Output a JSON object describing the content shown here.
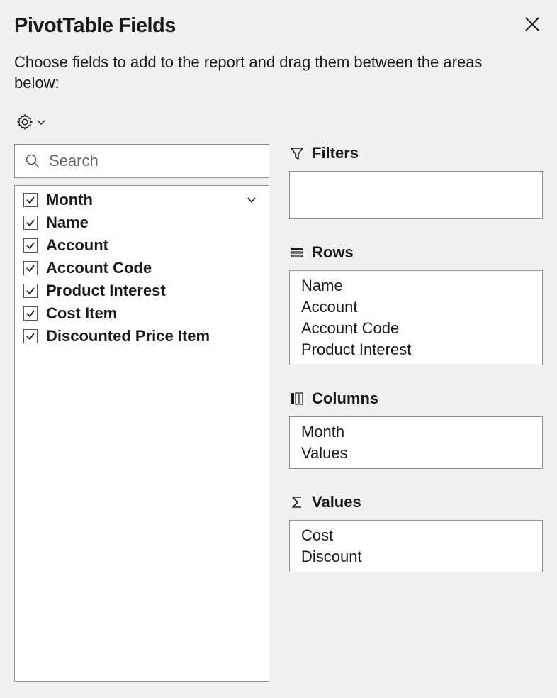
{
  "header": {
    "title": "PivotTable Fields"
  },
  "instruction": "Choose fields to add to the report and drag them between the areas below:",
  "search": {
    "placeholder": "Search",
    "value": ""
  },
  "fields": [
    {
      "label": "Month",
      "checked": true,
      "active": true
    },
    {
      "label": "Name",
      "checked": true,
      "active": false
    },
    {
      "label": "Account",
      "checked": true,
      "active": false
    },
    {
      "label": "Account Code",
      "checked": true,
      "active": false
    },
    {
      "label": "Product Interest",
      "checked": true,
      "active": false
    },
    {
      "label": "Cost Item",
      "checked": true,
      "active": false
    },
    {
      "label": "Discounted Price Item",
      "checked": true,
      "active": false
    }
  ],
  "areas": {
    "filters": {
      "label": "Filters",
      "items": []
    },
    "rows": {
      "label": "Rows",
      "items": [
        "Name",
        "Account",
        "Account Code",
        "Product Interest"
      ]
    },
    "columns": {
      "label": "Columns",
      "items": [
        "Month",
        "Values"
      ]
    },
    "values": {
      "label": "Values",
      "items": [
        "Cost",
        "Discount"
      ]
    }
  }
}
